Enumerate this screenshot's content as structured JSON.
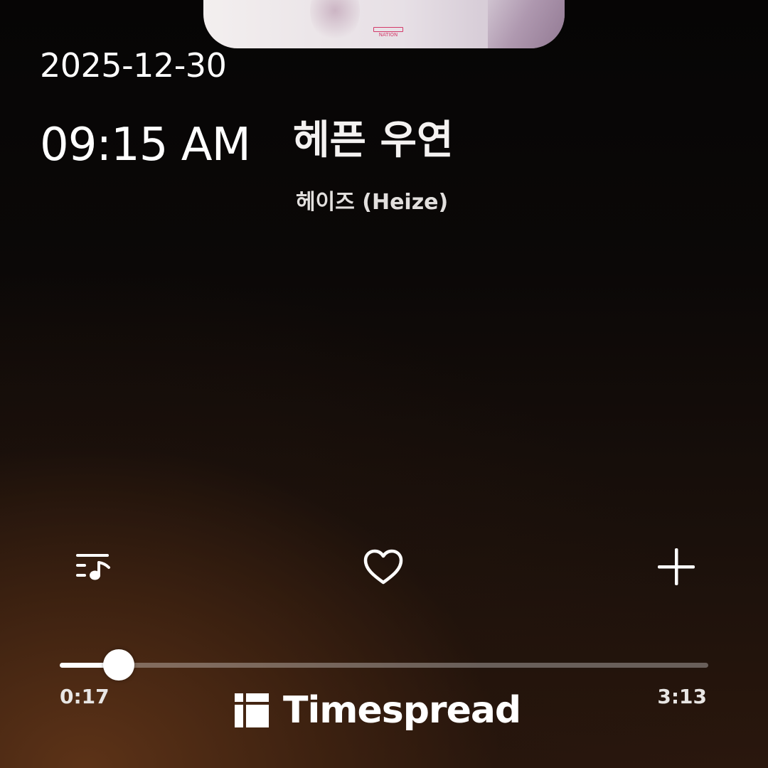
{
  "album": {
    "label_logo_text": "NATION",
    "art_icon": "album-art-image"
  },
  "clock": {
    "date": "2025-12-30",
    "time": "09:15 AM"
  },
  "track": {
    "title": "헤픈 우연",
    "artist": "헤이즈 (Heize)"
  },
  "actions": {
    "queue_icon": "queue-music-icon",
    "like_icon": "heart-icon",
    "add_icon": "plus-icon"
  },
  "playback": {
    "elapsed": "0:17",
    "total": "3:13",
    "progress_fraction": 0.0906
  },
  "brand": {
    "name": "Timespread",
    "logo_icon": "timespread-logo-icon"
  },
  "colors": {
    "accent": "#ffffff",
    "background_warm": "#5f3418",
    "background_dark": "#060505"
  }
}
